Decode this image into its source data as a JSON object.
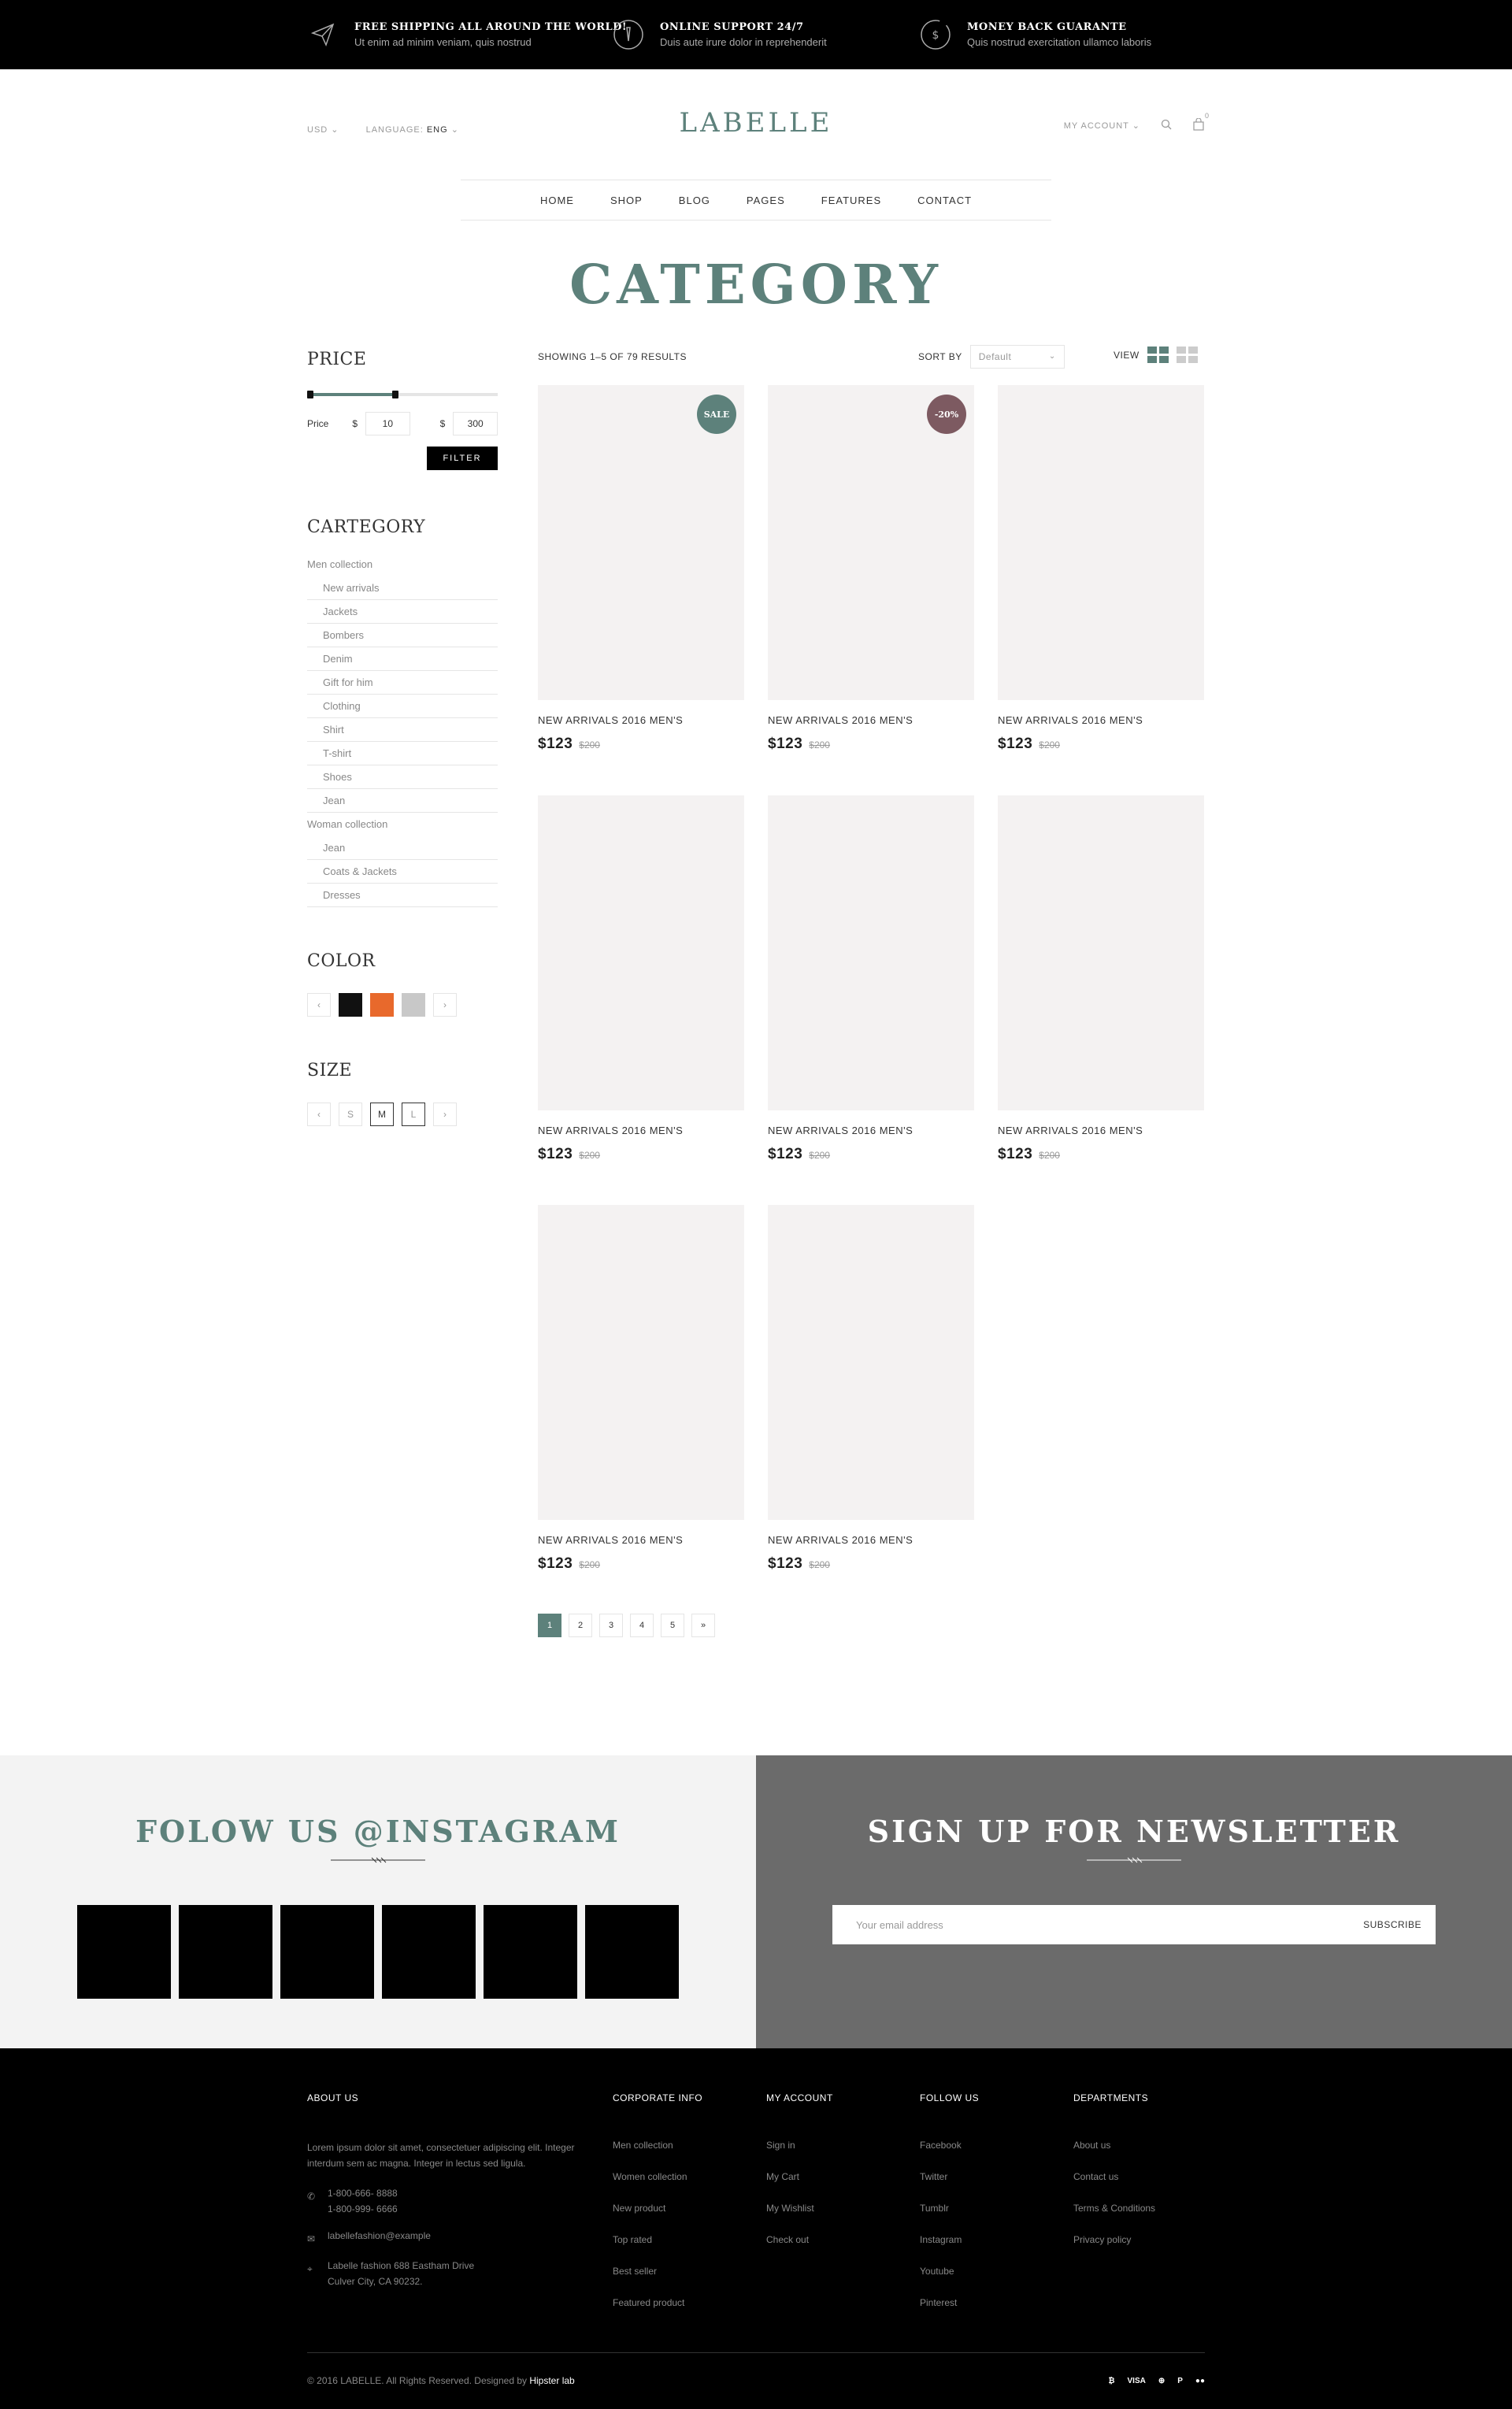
{
  "topbar": {
    "items": [
      {
        "title": "FREE SHIPPING ALL AROUND THE WORLD!",
        "sub": "Ut enim ad minim veniam, quis nostrud"
      },
      {
        "title": "ONLINE SUPPORT 24/7",
        "sub": "Duis aute irure dolor in reprehenderit"
      },
      {
        "title": "MONEY BACK GUARANTE",
        "sub": "Quis nostrud exercitation ullamco laboris"
      }
    ]
  },
  "header": {
    "currency": "USD",
    "language_label": "LANGUAGE:",
    "language_value": "ENG",
    "logo": "LABELLE",
    "account": "MY ACCOUNT",
    "cart_count": "0"
  },
  "nav": [
    "HOME",
    "SHOP",
    "BLOG",
    "PAGES",
    "FEATURES",
    "CONTACT"
  ],
  "page_title": "CATEGORY",
  "sidebar": {
    "price_heading": "PRICE",
    "price_label": "Price",
    "currency_symbol": "$",
    "min": "10",
    "max": "300",
    "filter_button": "FILTER",
    "category_heading": "CARTEGORY",
    "categories": [
      {
        "label": "Men collection",
        "level": 0
      },
      {
        "label": "New arrivals",
        "level": 1
      },
      {
        "label": "Jackets",
        "level": 1
      },
      {
        "label": "Bombers",
        "level": 1
      },
      {
        "label": "Denim",
        "level": 1
      },
      {
        "label": "Gift for him",
        "level": 1
      },
      {
        "label": "Clothing",
        "level": 1
      },
      {
        "label": "Shirt",
        "level": 1
      },
      {
        "label": "T-shirt",
        "level": 1
      },
      {
        "label": "Shoes",
        "level": 1
      },
      {
        "label": "Jean",
        "level": 1
      },
      {
        "label": "Woman collection",
        "level": 0
      },
      {
        "label": "Jean",
        "level": 1
      },
      {
        "label": "Coats & Jackets",
        "level": 1
      },
      {
        "label": "Dresses",
        "level": 1
      }
    ],
    "color_heading": "COLOR",
    "colors": [
      "#111111",
      "#e8692c",
      "#c8c8c8"
    ],
    "size_heading": "SIZE",
    "sizes": [
      "S",
      "M",
      "L"
    ],
    "prev": "‹",
    "next": "›"
  },
  "toolbar": {
    "results": "SHOWING 1–5 OF 79 RESULTS",
    "sort_label": "SORT BY",
    "sort_value": "Default",
    "view_label": "VIEW"
  },
  "products": [
    {
      "name": "NEW ARRIVALS 2016 MEN'S",
      "price": "$123",
      "old_price": "$200",
      "badge": "SALE",
      "badge_color": "#5d817b"
    },
    {
      "name": "NEW ARRIVALS 2016 MEN'S",
      "price": "$123",
      "old_price": "$200",
      "badge": "-20%",
      "badge_color": "#7d5a61"
    },
    {
      "name": "NEW ARRIVALS 2016 MEN'S",
      "price": "$123",
      "old_price": "$200",
      "badge": ""
    },
    {
      "name": "NEW ARRIVALS 2016 MEN'S",
      "price": "$123",
      "old_price": "$200",
      "badge": ""
    },
    {
      "name": "NEW ARRIVALS 2016 MEN'S",
      "price": "$123",
      "old_price": "$200",
      "badge": ""
    },
    {
      "name": "NEW ARRIVALS 2016 MEN'S",
      "price": "$123",
      "old_price": "$200",
      "badge": ""
    },
    {
      "name": "NEW ARRIVALS 2016 MEN'S",
      "price": "$123",
      "old_price": "$200",
      "badge": ""
    },
    {
      "name": "NEW ARRIVALS 2016 MEN'S",
      "price": "$123",
      "old_price": "$200",
      "badge": ""
    }
  ],
  "pagination": [
    "1",
    "2",
    "3",
    "4",
    "5",
    "»"
  ],
  "instagram": {
    "title": "FOLOW US @INSTAGRAM"
  },
  "newsletter": {
    "title": "SIGN UP FOR NEWSLETTER",
    "placeholder": "Your email address",
    "button": "SUBSCRIBE"
  },
  "footer": {
    "about_heading": "ABOUT US",
    "about_text": "Lorem ipsum dolor sit amet, consectetuer adipiscing elit. Integer interdum sem ac magna. Integer in lectus sed ligula.",
    "phone1": "1-800-666- 8888",
    "phone2": "1-800-999- 6666",
    "email": "labellefashion@example",
    "address1": "Labelle fashion 688 Eastham Drive",
    "address2": "Culver City, CA 90232.",
    "columns": [
      {
        "heading": "CORPORATE INFO",
        "links": [
          "Men collection",
          "Women collection",
          "New product",
          "Top rated",
          "Best seller",
          "Featured product"
        ]
      },
      {
        "heading": "MY ACCOUNT",
        "links": [
          "Sign in",
          "My Cart",
          "My Wishlist",
          "Check out"
        ]
      },
      {
        "heading": "FOLLOW US",
        "links": [
          "Facebook",
          "Twitter",
          "Tumblr",
          "Instagram",
          "Youtube",
          "Pinterest"
        ]
      },
      {
        "heading": "DEPARTMENTS",
        "links": [
          "About us",
          "Contact us",
          "Terms & Conditions",
          "Privacy policy"
        ]
      }
    ],
    "copyright": "© 2016 LABELLE. All Rights Reserved. Designed by",
    "designer": "Hipster lab",
    "payments": [
      "₿",
      "VISA",
      "⊕",
      "P",
      "●●"
    ]
  },
  "accent_color": "#5d817b"
}
